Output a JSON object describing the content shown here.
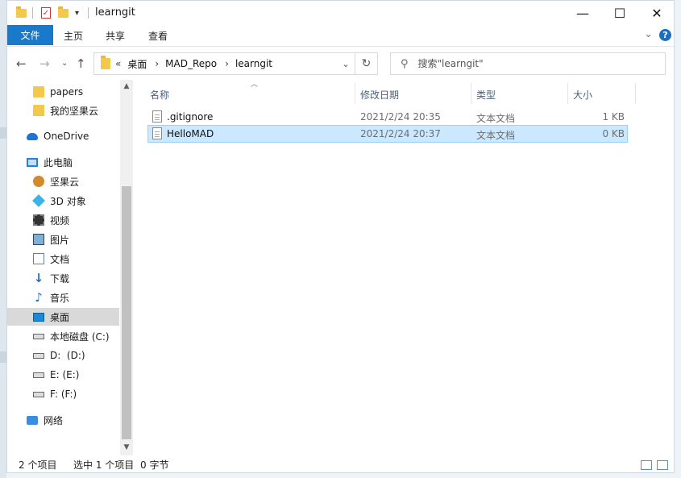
{
  "window": {
    "title": "learngit"
  },
  "ribbon": {
    "tabs": [
      "文件",
      "主页",
      "共享",
      "查看"
    ]
  },
  "address": {
    "crumbs": [
      "桌面",
      "MAD_Repo",
      "learngit"
    ],
    "overflow": "«"
  },
  "search": {
    "placeholder": "搜索\"learngit\""
  },
  "sidebar": {
    "items": [
      {
        "label": "papers",
        "icon": "folder-icon"
      },
      {
        "label": "我的坚果云",
        "icon": "folder-icon"
      },
      {
        "label": "OneDrive",
        "icon": "onedrive-icon"
      },
      {
        "label": "此电脑",
        "icon": "this-pc-icon"
      },
      {
        "label": "坚果云",
        "icon": "nutstore-icon"
      },
      {
        "label": "3D 对象",
        "icon": "3d-objects-icon"
      },
      {
        "label": "视频",
        "icon": "videos-icon"
      },
      {
        "label": "图片",
        "icon": "pictures-icon"
      },
      {
        "label": "文档",
        "icon": "documents-icon"
      },
      {
        "label": "下载",
        "icon": "downloads-icon"
      },
      {
        "label": "音乐",
        "icon": "music-icon"
      },
      {
        "label": "桌面",
        "icon": "desktop-icon"
      },
      {
        "label": "本地磁盘 (C:)",
        "icon": "drive-icon"
      },
      {
        "label": "D:  (D:)",
        "icon": "drive-icon"
      },
      {
        "label": "E: (E:)",
        "icon": "drive-icon"
      },
      {
        "label": "F: (F:)",
        "icon": "drive-icon"
      },
      {
        "label": "网络",
        "icon": "network-icon"
      }
    ]
  },
  "columns": {
    "name": "名称",
    "date": "修改日期",
    "type": "类型",
    "size": "大小"
  },
  "files": [
    {
      "name": ".gitignore",
      "date": "2021/2/24 20:35",
      "type": "文本文档",
      "size": "1 KB"
    },
    {
      "name": "HelloMAD",
      "date": "2021/2/24 20:37",
      "type": "文本文档",
      "size": "0 KB"
    }
  ],
  "status": {
    "count": "2 个项目",
    "selected": "选中 1 个项目",
    "bytes": "0 字节"
  }
}
